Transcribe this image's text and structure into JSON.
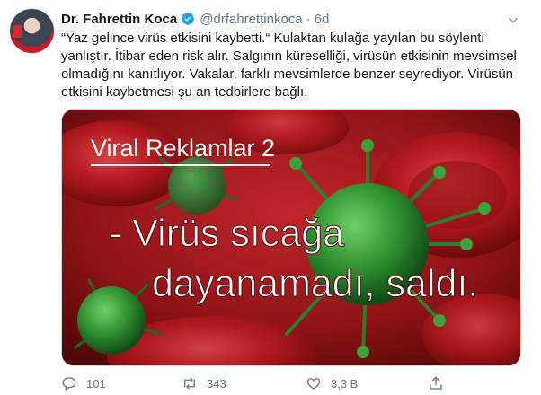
{
  "tweet": {
    "display_name": "Dr. Fahrettin Koca",
    "handle": "@drfahrettinkoca",
    "separator": "·",
    "time": "6d",
    "text_lines": [
      "“Yaz gelince virüs etkisini kaybetti.“ Kulaktan kulağa yayılan bu söylenti",
      "yanlıştır. İtibar eden risk alır. Salgının küreselliği, virüsün etkisinin mevsimsel",
      "olmadığını kanıtlıyor. Vakalar, farklı mevsimlerde benzer seyrediyor. Virüsün",
      "etkisini kaybetmesi şu an tedbirlere bağlı."
    ]
  },
  "media": {
    "title": "Viral Reklamlar 2",
    "headline_line1": "- Virüs sıcağa",
    "headline_line2": "dayanamadı, saldı."
  },
  "actions": {
    "replies": "101",
    "retweets": "343",
    "likes": "3,3 B"
  },
  "icons": {
    "verified": "verified-badge-icon",
    "caret": "chevron-down-icon",
    "reply": "reply-icon",
    "retweet": "retweet-icon",
    "like": "heart-icon",
    "share": "share-icon"
  },
  "colors": {
    "verified_blue": "#1da1f2",
    "meta_gray": "#657786",
    "image_red": "#9b1518",
    "virus_green": "#2f8f2f"
  }
}
